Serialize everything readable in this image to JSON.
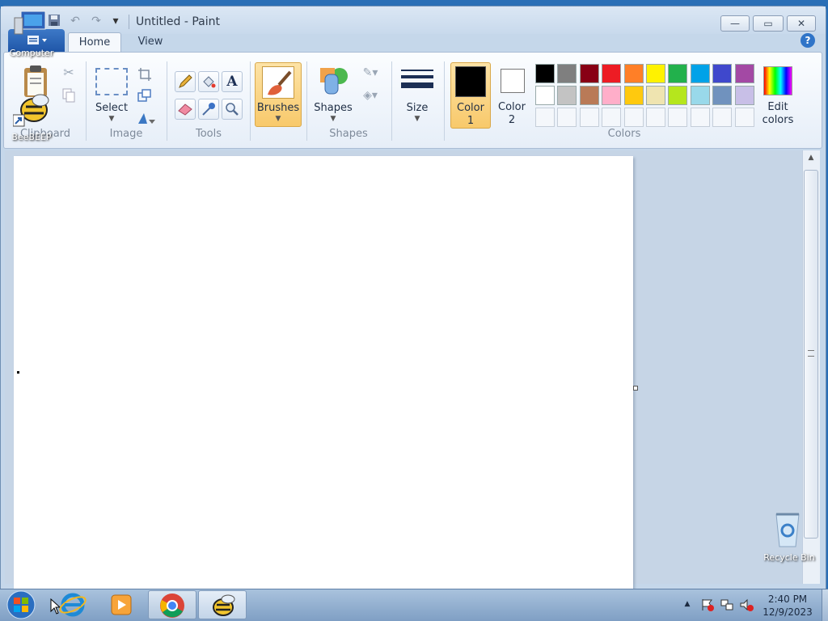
{
  "window": {
    "title": "Untitled - Paint"
  },
  "quick_access": {
    "save": "save-icon",
    "undo": "undo-icon",
    "redo": "redo-icon",
    "customize": "▾"
  },
  "window_buttons": {
    "minimize": "—",
    "maximize": "▭",
    "close": "✕"
  },
  "tabs": [
    {
      "label": "Home"
    },
    {
      "label": "View"
    }
  ],
  "ribbon": {
    "clipboard": {
      "group": "Clipboard"
    },
    "image": {
      "group": "Image",
      "select_label": "Select"
    },
    "tools": {
      "group": "Tools"
    },
    "brushes": {
      "label": "Brushes"
    },
    "shapes": {
      "group": "Shapes",
      "shapes_label": "Shapes"
    },
    "size": {
      "label": "Size"
    },
    "color1": {
      "label_line1": "Color",
      "label_line2": "1",
      "value": "#000000"
    },
    "color2": {
      "label_line1": "Color",
      "label_line2": "2",
      "value": "#ffffff"
    },
    "colors": {
      "group": "Colors",
      "row1": [
        "#000000",
        "#7f7f7f",
        "#880015",
        "#ed1c24",
        "#ff7f27",
        "#fff200",
        "#22b14c",
        "#00a2e8",
        "#3f48cc",
        "#a349a4"
      ],
      "row2": [
        "#ffffff",
        "#c3c3c3",
        "#b97a57",
        "#ffaec9",
        "#ffc90e",
        "#efe4b0",
        "#b5e61d",
        "#99d9ea",
        "#7092be",
        "#c8bfe7"
      ]
    },
    "edit_colors": {
      "line1": "Edit",
      "line2": "colors"
    }
  },
  "desktop": {
    "computer": "Computer",
    "beebeep": "BeeBEEP",
    "recycle_bin": "Recycle Bin"
  },
  "taskbar": {
    "time": "2:40 PM",
    "date": "12/9/2023",
    "tray_arrow": "▲"
  }
}
